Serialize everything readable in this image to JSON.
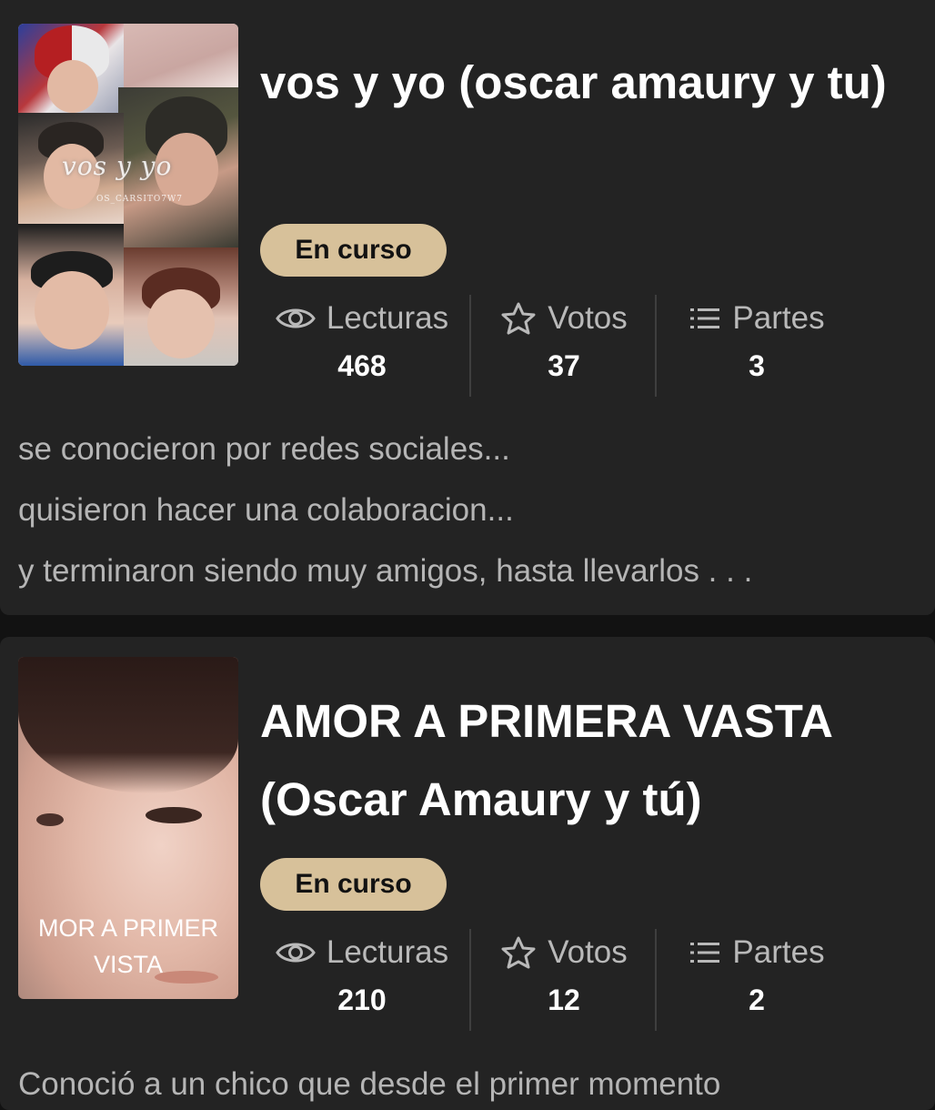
{
  "stories": [
    {
      "cover_text": "vos y yo",
      "cover_handle": "OS_CARSITO7W7",
      "title": "vos y yo (oscar amaury y tu)",
      "status": "En curso",
      "stats": [
        {
          "icon": "eye-icon",
          "label": "Lecturas",
          "value": "468"
        },
        {
          "icon": "star-icon",
          "label": "Votos",
          "value": "37"
        },
        {
          "icon": "list-icon",
          "label": "Partes",
          "value": "3"
        }
      ],
      "description": [
        "se conocieron por redes sociales...",
        "quisieron hacer una colaboracion...",
        "y terminaron siendo muy amigos, hasta llevarlos . . ."
      ]
    },
    {
      "cover_text": "AMOR A PRIMERA\nVISTA",
      "title": "AMOR A PRIMERA VASTA (Oscar Amaury y tú)",
      "status": "En curso",
      "stats": [
        {
          "icon": "eye-icon",
          "label": "Lecturas",
          "value": "210"
        },
        {
          "icon": "star-icon",
          "label": "Votos",
          "value": "12"
        },
        {
          "icon": "list-icon",
          "label": "Partes",
          "value": "2"
        }
      ],
      "description": [
        "Conoció  a un chico que desde el primer momento"
      ]
    }
  ],
  "colors": {
    "background": "#121212",
    "card": "#232323",
    "badge": "#d7c19a",
    "muted_text": "#b9b9b9"
  }
}
